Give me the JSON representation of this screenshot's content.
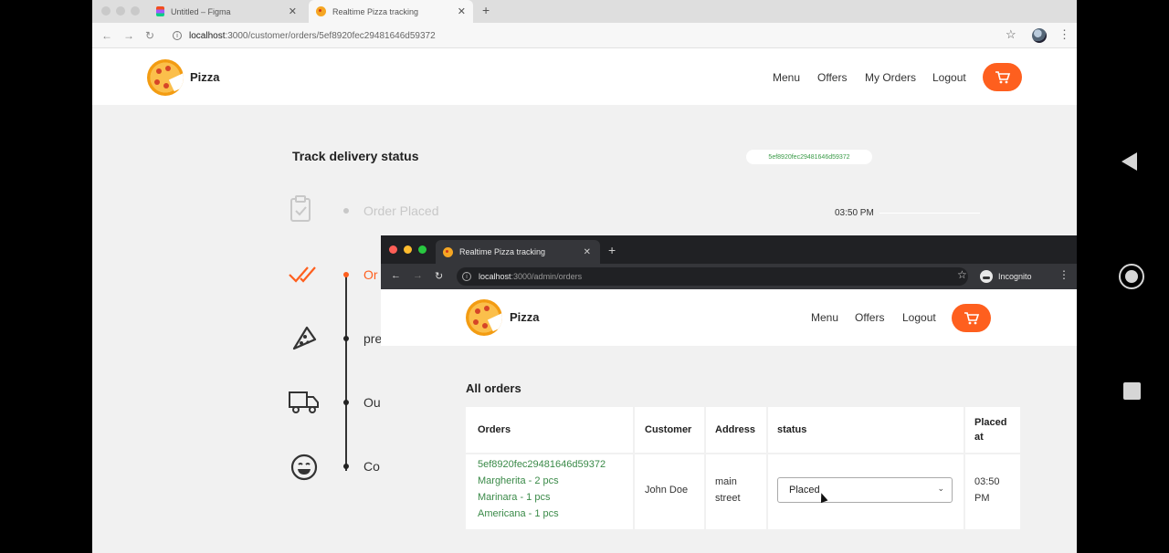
{
  "back_window": {
    "tabs": [
      {
        "title": "Untitled – Figma",
        "icon": "figma-icon"
      },
      {
        "title": "Realtime Pizza tracking",
        "icon": "pizza-favicon-icon",
        "active": true
      }
    ],
    "url": {
      "host": "localhost",
      "path": ":3000/customer/orders/5ef8920fec29481646d59372"
    },
    "brand": "Pizza",
    "nav": [
      "Menu",
      "Offers",
      "My Orders",
      "Logout"
    ],
    "page_title": "Track delivery status",
    "order_id": "5ef8920fec29481646d59372",
    "steps": [
      {
        "label": "Order Placed",
        "icon": "clipboard-check-icon",
        "time": "03:50 PM"
      },
      {
        "label": "Or",
        "icon": "double-check-icon"
      },
      {
        "label": "pre",
        "icon": "pizza-slice-icon"
      },
      {
        "label": "Ou",
        "icon": "delivery-truck-icon"
      },
      {
        "label": "Co",
        "icon": "smiley-icon"
      }
    ]
  },
  "front_window": {
    "tab_title": "Realtime Pizza tracking",
    "url": {
      "host": "localhost",
      "path": ":3000/admin/orders"
    },
    "incognito_label": "Incognito",
    "brand": "Pizza",
    "nav": [
      "Menu",
      "Offers",
      "Logout"
    ],
    "section_title": "All orders",
    "table": {
      "headers": {
        "orders": "Orders",
        "customer": "Customer",
        "address": "Address",
        "status": "status",
        "placed_at_1": "Placed",
        "placed_at_2": "at"
      },
      "rows": [
        {
          "order_id": "5ef8920fec29481646d59372",
          "items": [
            "Margherita - 2 pcs",
            "Marinara - 1 pcs",
            "Americana - 1 pcs"
          ],
          "customer": "John Doe",
          "address_1": "main",
          "address_2": "street",
          "status": "Placed",
          "placed_1": "03:50",
          "placed_2": "PM"
        }
      ]
    }
  },
  "colors": {
    "accent": "#fe5f1e",
    "link_green": "#3a8a48",
    "page_bg": "#f1f1f1"
  }
}
